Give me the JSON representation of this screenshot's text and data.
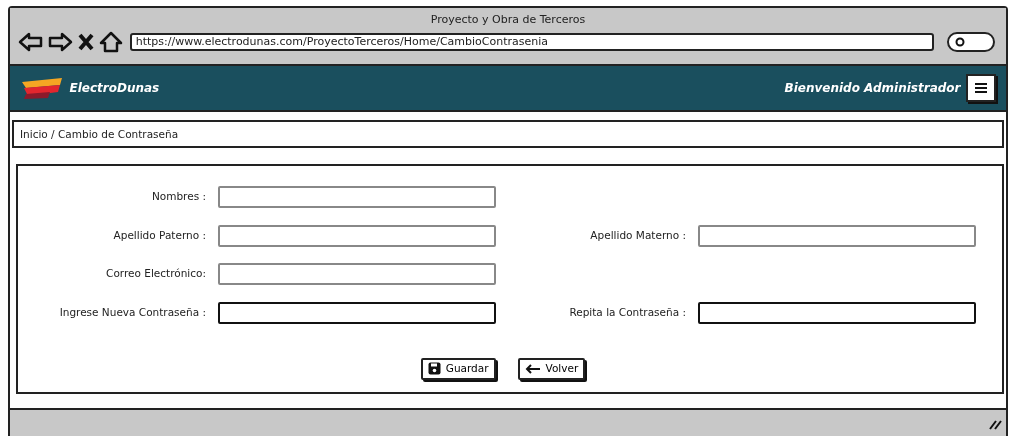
{
  "window": {
    "title": "Proyecto y Obra de Terceros",
    "url": "https://www.electrodunas.com/ProyectoTerceros/Home/CambioContrasenia"
  },
  "navbar": {
    "brand": "ElectroDunas",
    "welcome": "Bienvenido Administrador"
  },
  "breadcrumb": "Inicio / Cambio de Contraseña",
  "form_rows": [
    [
      {
        "label": "Nombres :",
        "kind": "text"
      }
    ],
    [
      {
        "label": "Apellido Paterno :",
        "kind": "text"
      },
      {
        "label": "Apellido Materno :",
        "kind": "text"
      }
    ],
    [
      {
        "label": "Correo Electrónico:",
        "kind": "text"
      }
    ],
    [
      {
        "label": "Ingrese Nueva Contraseña :",
        "kind": "password"
      },
      {
        "label": "Repita la Contraseña :",
        "kind": "password"
      }
    ]
  ],
  "buttons": [
    {
      "label": "Guardar",
      "kind": "save"
    },
    {
      "label": "Volver",
      "kind": "back"
    }
  ]
}
